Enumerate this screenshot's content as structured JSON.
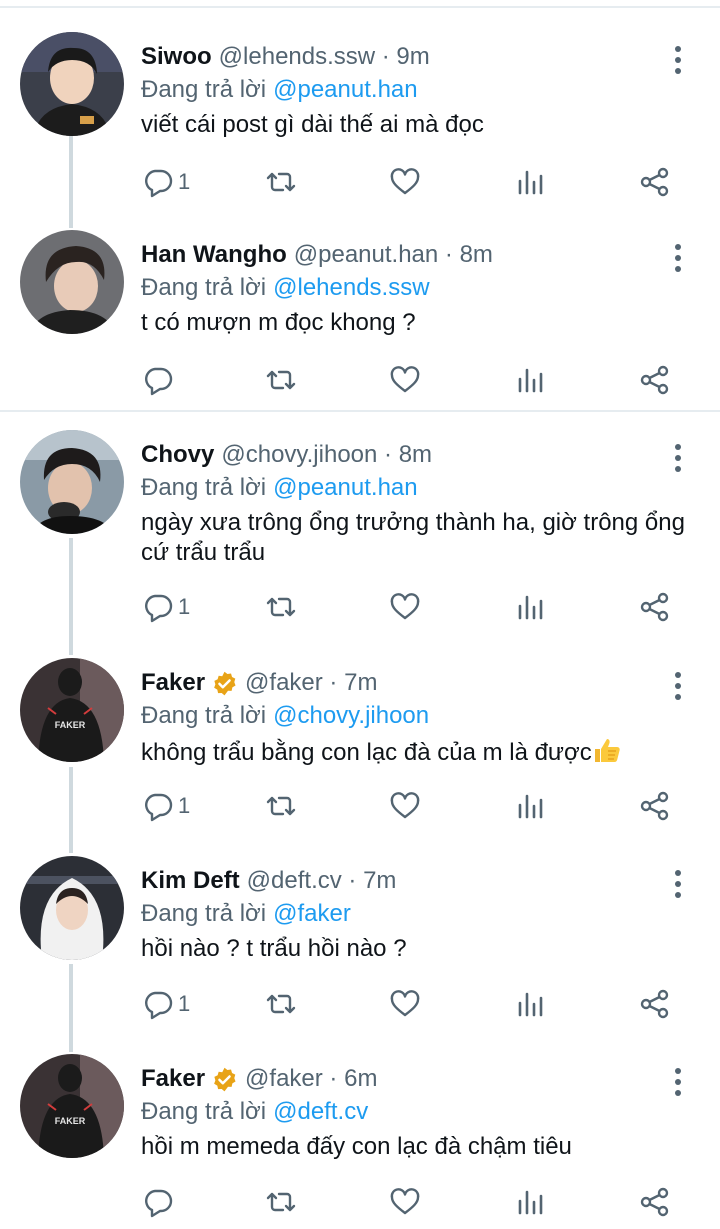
{
  "colors": {
    "link": "#1d9bf0",
    "secondary": "#536471",
    "text": "#0f1419",
    "verified": "#e8a317",
    "thread_line": "#cfd9de"
  },
  "tweets": [
    {
      "name": "Siwoo",
      "verified": false,
      "handle": "@lehends.ssw · 9m",
      "reply_label": "Đang trả lời",
      "reply_to": "@peanut.han",
      "text": "viết cái post gì dài thế ai mà đọc",
      "reply_count": "1"
    },
    {
      "name": "Han Wangho",
      "verified": false,
      "handle": "@peanut.han · 8m",
      "reply_label": "Đang trả lời",
      "reply_to": "@lehends.ssw",
      "text": "t có mượn m đọc khong ?",
      "reply_count": ""
    },
    {
      "name": "Chovy",
      "verified": false,
      "handle": "@chovy.jihoon · 8m",
      "reply_label": "Đang trả lời",
      "reply_to": "@peanut.han",
      "text": "ngày xưa trông ổng trưởng thành ha, giờ trông ổng cứ trẩu trẩu",
      "reply_count": "1"
    },
    {
      "name": "Faker",
      "verified": true,
      "handle": "@faker · 7m",
      "reply_label": "Đang trả lời",
      "reply_to": "@chovy.jihoon",
      "text": "không trẩu bằng con lạc đà của m là được",
      "emoji": "thumbs-up",
      "reply_count": "1"
    },
    {
      "name": "Kim Deft",
      "verified": false,
      "handle": "@deft.cv · 7m",
      "reply_label": "Đang trả lời",
      "reply_to": "@faker",
      "text": "hồi nào ? t trẩu hồi nào ?",
      "reply_count": "1"
    },
    {
      "name": "Faker",
      "verified": true,
      "handle": "@faker · 6m",
      "reply_label": "Đang trả lời",
      "reply_to": "@deft.cv",
      "text": "hồi m memeda đấy con lạc đà chậm tiêu",
      "reply_count": ""
    }
  ],
  "avatar_texts": {
    "jersey": "FAKER"
  },
  "icons": [
    "reply-icon",
    "retweet-icon",
    "like-icon",
    "stats-icon",
    "share-icon",
    "more-icon",
    "verified-icon"
  ]
}
